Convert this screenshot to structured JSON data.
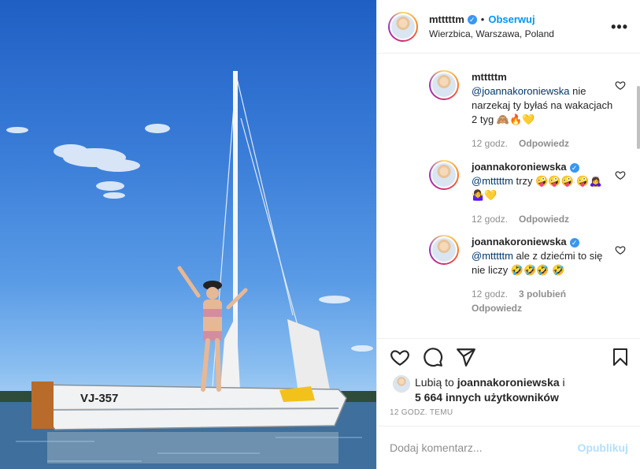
{
  "header": {
    "username": "mtttttm",
    "verified_mark": "✓",
    "separator": "•",
    "follow_label": "Obserwuj",
    "location": "Wierzbica, Warszawa, Poland",
    "more_icon": "more-horizontal-icon"
  },
  "photo": {
    "boat_registration": "VJ-357"
  },
  "comments": [
    {
      "username": "mtttttm",
      "verified": false,
      "mention": "@joannakoroniewska",
      "text": " nie narzekaj ty byłaś na wakacjach 2 tyg 🙈🔥💛",
      "time": "12 godz.",
      "likes": "",
      "reply_label": "Odpowiedz"
    },
    {
      "username": "joannakoroniewska",
      "verified": true,
      "mention": "@mtttttm",
      "text": " trzy 🤪🤪🤪 🤪🙇‍♀️🤷‍♀️💛",
      "time": "12 godz.",
      "likes": "",
      "reply_label": "Odpowiedz"
    },
    {
      "username": "joannakoroniewska",
      "verified": true,
      "mention": "@mtttttm",
      "text": " ale z dziećmi to się nie liczy 🤣🤣🤣 🤣",
      "time": "12 godz.",
      "likes": "3 polubień",
      "reply_label": "Odpowiedz"
    }
  ],
  "actions": {
    "like_icon": "heart-icon",
    "comment_icon": "comment-icon",
    "share_icon": "share-icon",
    "save_icon": "bookmark-icon"
  },
  "likes": {
    "prefix": "Lubią to ",
    "first_user": "joannakoroniewska",
    "connector": " i",
    "others": "5 664 innych użytkowników"
  },
  "time_ago": "12 GODZ. TEMU",
  "add_comment": {
    "placeholder": "Dodaj komentarz...",
    "publish_label": "Opublikuj"
  }
}
